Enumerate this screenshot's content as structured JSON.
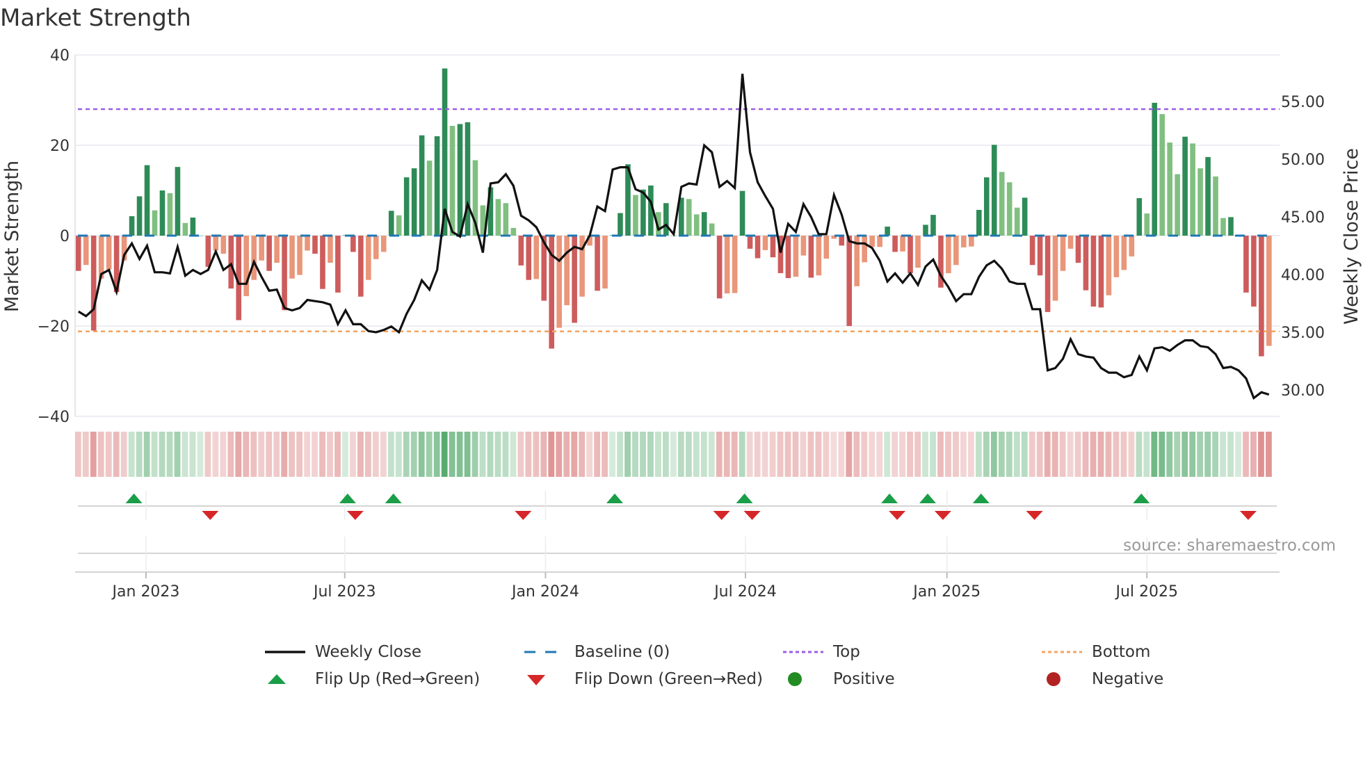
{
  "title": "Market Strength",
  "source": "source: sharemaestro.com",
  "colors": {
    "pos_strong": "#2e8b57",
    "pos_weak": "#80bf80",
    "neg_strong": "#cd5c5c",
    "neg_weak": "#e9967a",
    "price": "#111111",
    "baseline": "#1f77b4",
    "top": "#9b5de5",
    "bottom": "#f4a460",
    "flip_up": "#1a9e48",
    "flip_down": "#d62728",
    "positive": "#228b22",
    "negative": "#b22222"
  },
  "legend": [
    {
      "label": "Weekly Close",
      "symbol": "line"
    },
    {
      "label": "Baseline (0)",
      "symbol": "dash"
    },
    {
      "label": "Top",
      "symbol": "dot-purple"
    },
    {
      "label": "Bottom",
      "symbol": "dot-orange"
    },
    {
      "label": "Flip Up (Red→Green)",
      "symbol": "triangle-up"
    },
    {
      "label": "Flip Down (Green→Red)",
      "symbol": "triangle-down"
    },
    {
      "label": "Positive",
      "symbol": "circle-green"
    },
    {
      "label": "Negative",
      "symbol": "circle-red"
    }
  ],
  "chart_data": {
    "type": "bar",
    "title": "Market Strength",
    "ylabel": "Market Strength",
    "y2label": "Weekly Close Price",
    "ylim": [
      -40,
      40
    ],
    "y2lim": [
      27.35,
      59.0
    ],
    "yticks": [
      "40",
      "20",
      "0",
      "−20",
      "−40"
    ],
    "ytick_values": [
      40,
      20,
      0,
      -20,
      -40
    ],
    "y2ticks": [
      "55.00",
      "50.00",
      "45.00",
      "40.00",
      "35.00",
      "30.00"
    ],
    "y2tick_values": [
      55,
      50,
      45,
      40,
      35,
      30
    ],
    "x_unit": "week index",
    "xticks": [
      {
        "label": "Jan 2023",
        "week": 8.86
      },
      {
        "label": "Jul 2023",
        "week": 34.9
      },
      {
        "label": "Jan 2024",
        "week": 61.2
      },
      {
        "label": "Jul 2024",
        "week": 87.4
      },
      {
        "label": "Jan 2025",
        "week": 113.8
      },
      {
        "label": "Jul 2025",
        "week": 140.0
      }
    ],
    "top_level": 28,
    "bottom_level": -21.2,
    "baseline": 0,
    "strength": [
      -7.8,
      -6.5,
      -21,
      -9.5,
      -7.5,
      -12.5,
      -5.5,
      4.3,
      8.7,
      15.6,
      5.6,
      10,
      9.4,
      15.2,
      2.8,
      4,
      0,
      -6.9,
      -3.3,
      -4,
      -11.7,
      -18.7,
      -13.4,
      -9.8,
      -5.5,
      -7.8,
      -6,
      -16.5,
      -9.5,
      -8.7,
      -3.3,
      -4,
      -11.8,
      -6,
      -12.6,
      0.1,
      -3.6,
      -13.5,
      -9.8,
      -5.2,
      -3.6,
      5.5,
      4.5,
      12.9,
      14.9,
      22.2,
      16.6,
      22,
      37,
      24.3,
      24.7,
      25.1,
      16.7,
      6.7,
      10.7,
      8.1,
      7.2,
      1.7,
      -6.6,
      -9.8,
      -9.6,
      -14.4,
      -25,
      -20.4,
      -15.4,
      -19.3,
      -13.5,
      -2.2,
      -12.2,
      -11.7,
      0.1,
      5,
      15.8,
      9,
      10.2,
      11.1,
      5.2,
      7.2,
      0,
      8.4,
      8.1,
      4.7,
      5.2,
      2.7,
      -13.9,
      -12.8,
      -12.7,
      9.9,
      -2.9,
      -5,
      -3.2,
      -4.8,
      -8.3,
      -9.4,
      -9.1,
      -4.4,
      -9.3,
      -8.8,
      -5.1,
      -0.7,
      -2.2,
      -20,
      -11.2,
      -5.9,
      -2.5,
      -2.5,
      2,
      -3.6,
      -3.5,
      -8.3,
      -7.1,
      2.4,
      4.6,
      -11.5,
      -8.3,
      -6.5,
      -2.6,
      -2.4,
      5.7,
      12.9,
      20.1,
      14.1,
      11.8,
      6.2,
      8.4,
      -6.5,
      -8.8,
      -16.9,
      -14.4,
      -7.8,
      -2.9,
      -6,
      -12.1,
      -15.7,
      -15.9,
      -13.2,
      -9.2,
      -7.6,
      -4.6,
      8.3,
      4.9,
      29.4,
      26.9,
      20.6,
      13.6,
      21.9,
      20.4,
      14.9,
      17.4,
      13.1,
      3.9,
      4.1,
      0,
      -12.6,
      -15.7,
      -26.7,
      -24.4
    ],
    "strong": [
      1,
      0,
      1,
      0,
      0,
      1,
      0,
      1,
      1,
      1,
      0,
      1,
      0,
      1,
      0,
      1,
      0,
      1,
      0,
      0,
      1,
      1,
      0,
      0,
      0,
      1,
      0,
      1,
      0,
      0,
      0,
      1,
      1,
      0,
      1,
      1,
      1,
      1,
      0,
      0,
      0,
      1,
      0,
      1,
      1,
      1,
      0,
      1,
      1,
      0,
      1,
      1,
      0,
      0,
      1,
      0,
      0,
      0,
      1,
      1,
      0,
      1,
      1,
      0,
      0,
      1,
      0,
      0,
      1,
      0,
      1,
      1,
      1,
      0,
      1,
      1,
      0,
      1,
      0,
      1,
      0,
      0,
      1,
      0,
      1,
      0,
      0,
      1,
      1,
      1,
      0,
      1,
      1,
      1,
      0,
      0,
      1,
      0,
      0,
      0,
      1,
      1,
      0,
      0,
      0,
      0,
      1,
      1,
      0,
      1,
      0,
      1,
      1,
      1,
      0,
      0,
      0,
      0,
      1,
      1,
      1,
      0,
      0,
      0,
      1,
      1,
      1,
      1,
      0,
      0,
      0,
      1,
      1,
      1,
      1,
      0,
      0,
      0,
      0,
      1,
      0,
      1,
      0,
      0,
      0,
      1,
      0,
      0,
      1,
      0,
      0,
      1,
      0,
      1,
      1,
      1,
      0
    ],
    "weekly_close": [
      36.8,
      36.4,
      37.0,
      40.05,
      40.4,
      38.5,
      41.7,
      42.7,
      41.35,
      42.5,
      40.2,
      40.2,
      40.1,
      42.4,
      39.9,
      40.4,
      40.05,
      40.4,
      42.0,
      40.4,
      40.9,
      39.2,
      39.2,
      41.1,
      39.8,
      38.6,
      38.7,
      37.1,
      36.9,
      37.1,
      37.8,
      37.7,
      37.6,
      37.4,
      35.7,
      36.9,
      35.7,
      35.7,
      35.1,
      35.0,
      35.2,
      35.5,
      35.0,
      36.6,
      37.8,
      39.5,
      38.7,
      40.4,
      45.7,
      43.7,
      43.3,
      46.1,
      44.5,
      41.9,
      47.9,
      48.0,
      48.7,
      47.7,
      45.1,
      44.7,
      44.1,
      42.8,
      41.7,
      41.2,
      41.9,
      42.4,
      42.2,
      43.4,
      45.9,
      45.5,
      49.1,
      49.3,
      49.3,
      47.4,
      47.1,
      46.3,
      43.9,
      44.3,
      43.5,
      47.6,
      47.9,
      47.8,
      51.2,
      50.6,
      47.6,
      48.1,
      47.5,
      57.4,
      50.6,
      48.0,
      46.8,
      45.7,
      41.9,
      44.4,
      43.7,
      46.1,
      45.0,
      43.5,
      43.5,
      46.9,
      45.2,
      42.9,
      42.7,
      42.7,
      42.3,
      41.2,
      39.4,
      40.1,
      39.3,
      40.1,
      39.1,
      40.7,
      41.3,
      39.9,
      38.9,
      37.7,
      38.3,
      38.3,
      39.8,
      40.8,
      41.2,
      40.5,
      39.4,
      39.2,
      39.2,
      37.0,
      37.0,
      31.7,
      31.9,
      32.7,
      34.4,
      33.1,
      32.9,
      32.8,
      31.9,
      31.5,
      31.5,
      31.1,
      31.3,
      32.9,
      31.7,
      33.6,
      33.7,
      33.4,
      33.9,
      34.3,
      34.3,
      33.8,
      33.7,
      33.1,
      31.9,
      32.0,
      31.7,
      31.0,
      29.3,
      29.8,
      29.6
    ],
    "flip_up_weeks": [
      7,
      35,
      41,
      70,
      87,
      106,
      111,
      118,
      139
    ],
    "flip_down_weeks": [
      17,
      36,
      58,
      84,
      88,
      107,
      113,
      125,
      153
    ],
    "legend_position": "bottom"
  }
}
